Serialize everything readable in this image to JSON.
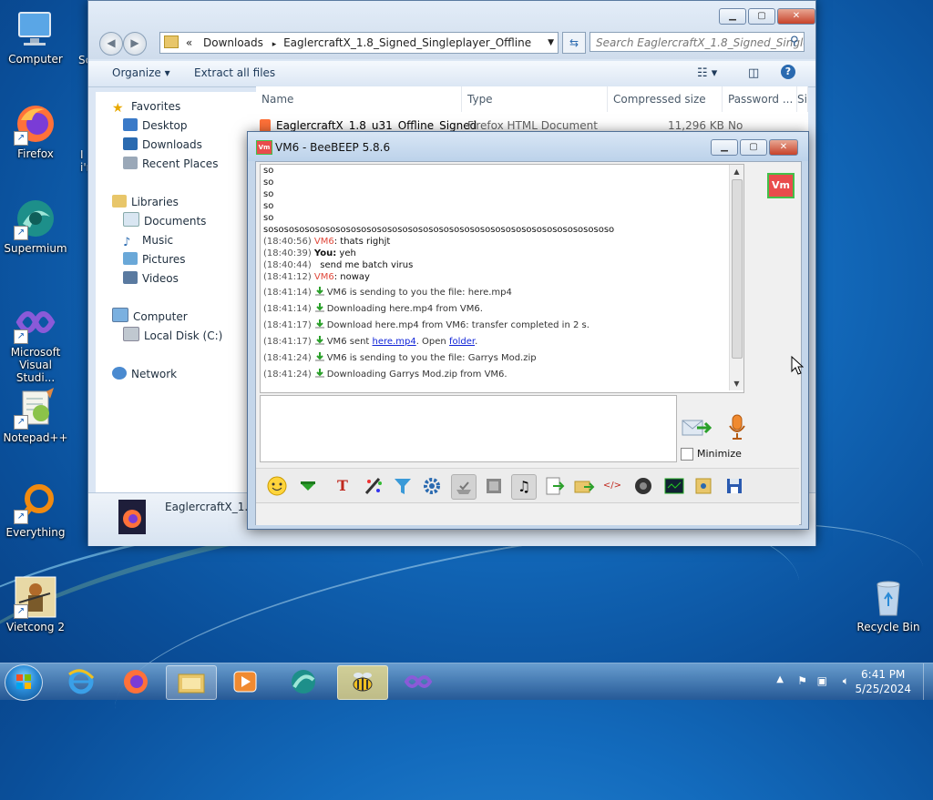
{
  "desktop": {
    "icons": [
      {
        "label": "Computer",
        "icon": "computer-icon"
      },
      {
        "label": "Firefox",
        "icon": "firefox-icon"
      },
      {
        "label": "Supermium",
        "icon": "supermium-icon"
      },
      {
        "label": "Microsoft Visual Studi...",
        "icon": "visual-studio-icon"
      },
      {
        "label": "Notepad++",
        "icon": "notepadpp-icon"
      },
      {
        "label": "Everything",
        "icon": "everything-icon"
      },
      {
        "label": "Vietcong 2",
        "icon": "vietcong-icon"
      },
      {
        "label": "Recycle Bin",
        "icon": "recycle-bin-icon"
      }
    ],
    "partial_labels": [
      "Sc",
      "I",
      "i'n"
    ]
  },
  "explorer": {
    "address_parts": [
      "«",
      "Downloads",
      "▸",
      "EaglercraftX_1.8_Signed_Singleplayer_Offline"
    ],
    "search_placeholder": "Search EaglercraftX_1.8_Signed_Single...",
    "toolbar": {
      "organize": "Organize ▾",
      "extract": "Extract all files"
    },
    "nav": {
      "favorites": "Favorites",
      "desktop": "Desktop",
      "downloads": "Downloads",
      "recent": "Recent Places",
      "libraries": "Libraries",
      "documents": "Documents",
      "music": "Music",
      "pictures": "Pictures",
      "videos": "Videos",
      "computer": "Computer",
      "local_disk": "Local Disk (C:)",
      "network": "Network"
    },
    "columns": [
      "Name",
      "Type",
      "Compressed size",
      "Password ...",
      "Si"
    ],
    "file": {
      "name": "EaglercraftX_1.8_u31_Offline_Signed",
      "type": "Firefox HTML Document",
      "size": "11,296 KB",
      "password": "No"
    },
    "details_name": "EaglercraftX_1.8_"
  },
  "beebeep": {
    "title": "VM6 - BeeBEEP 5.8.6",
    "avatar_text": "Vm",
    "lines": [
      {
        "text": "so"
      },
      {
        "text": "so"
      },
      {
        "text": "so"
      },
      {
        "text": "so"
      },
      {
        "text": "so"
      },
      {
        "text": "sosososososososososososososososososososososososososososososososososo"
      },
      {
        "time": "(18:40:56)",
        "who": "VM6",
        "msg": ": thats righjt"
      },
      {
        "time": "(18:40:39)",
        "who": "You:",
        "msg": " yeh"
      },
      {
        "time": "(18:40:44)",
        "who": "",
        "msg": "   send me batch virus"
      },
      {
        "time": "(18:41:12)",
        "who": "VM6",
        "msg": ": noway"
      }
    ],
    "sys_lines": [
      {
        "time": "(18:41:14)",
        "msg": "VM6 is sending to you the file: here.mp4"
      },
      {
        "time": "(18:41:14)",
        "msg": "Downloading here.mp4 from VM6."
      },
      {
        "time": "(18:41:17)",
        "msg": "Download here.mp4 from VM6: transfer completed in 2 s."
      },
      {
        "time": "(18:41:24)",
        "msg": "VM6 is sending to you the file: Garrys Mod.zip"
      },
      {
        "time": "(18:41:24)",
        "msg": "Downloading Garrys Mod.zip from VM6."
      }
    ],
    "sent_line": {
      "time": "(18:41:17)",
      "pre": "VM6 sent ",
      "link1": "here.mp4",
      "mid": ". Open ",
      "link2": "folder",
      "post": "."
    },
    "minimize_label": "Minimize"
  },
  "taskbar": {
    "time": "6:41 PM",
    "date": "5/25/2024"
  },
  "colors": {
    "accent_red": "#e0473a",
    "link_blue": "#1024d8",
    "avatar_bg": "#e94c4c",
    "avatar_border": "#43c04a"
  }
}
